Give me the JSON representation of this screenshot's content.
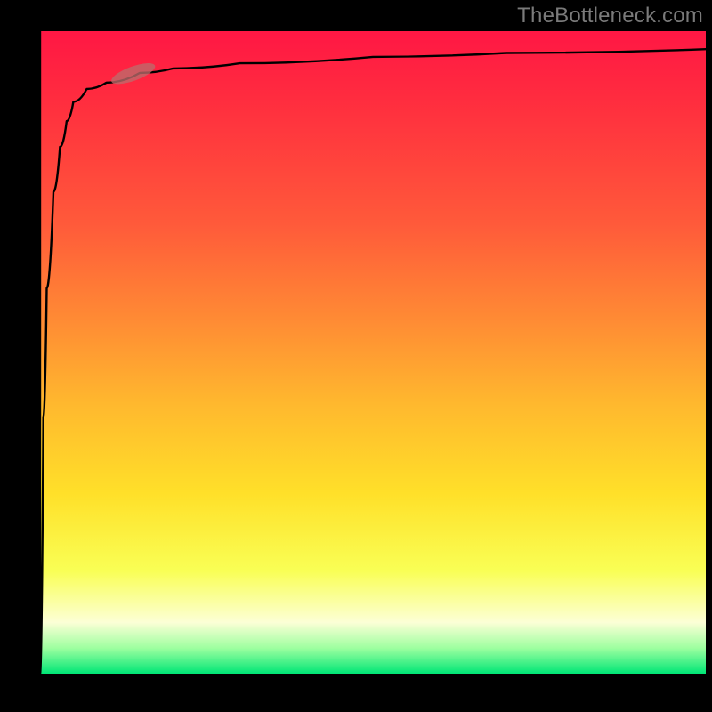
{
  "watermark": "TheBottleneck.com",
  "chart_data": {
    "type": "line",
    "title": "",
    "xlabel": "",
    "ylabel": "",
    "xlim": [
      0,
      100
    ],
    "ylim": [
      0,
      100
    ],
    "grid": false,
    "legend": false,
    "gradient_colors": [
      "#ff1744",
      "#ff8b34",
      "#ffe029",
      "#fcffd6",
      "#00e676"
    ],
    "series": [
      {
        "name": "curve",
        "x": [
          0,
          0.5,
          1,
          2,
          3,
          4,
          5,
          7,
          10,
          15,
          20,
          30,
          50,
          70,
          100
        ],
        "values": [
          0,
          40,
          60,
          75,
          82,
          86,
          89,
          91,
          92,
          93.5,
          94.2,
          95,
          96,
          96.6,
          97.2
        ]
      }
    ],
    "marker": {
      "x": 14,
      "y": 93.4,
      "angle_deg": 20
    }
  }
}
